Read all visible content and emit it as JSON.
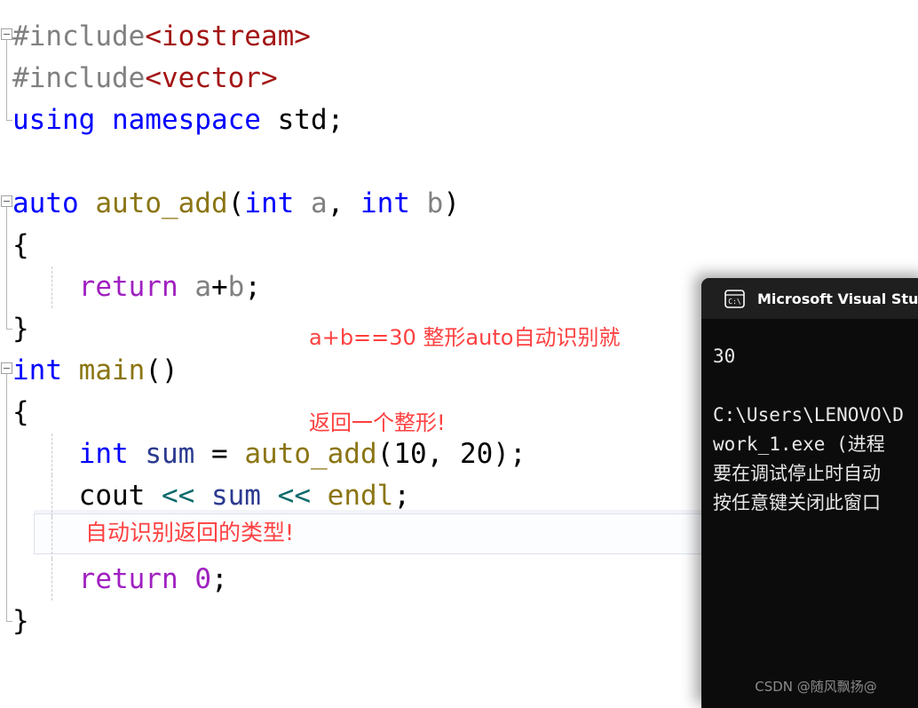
{
  "editor": {
    "name": "visual-studio-code-editor",
    "background": "#ffffff",
    "lines": [
      {
        "id": "l1",
        "fold": "start",
        "indent": false,
        "tokens": [
          {
            "text": "#include",
            "cls": "t-pre"
          },
          {
            "text": "<iostream>",
            "cls": "t-str"
          }
        ]
      },
      {
        "id": "l2",
        "fold": "mid",
        "indent": false,
        "tokens": [
          {
            "text": "#include",
            "cls": "t-pre"
          },
          {
            "text": "<vector>",
            "cls": "t-str"
          }
        ]
      },
      {
        "id": "l3",
        "fold": "endcap",
        "indent": false,
        "tokens": [
          {
            "text": "using namespace ",
            "cls": "t-kw"
          },
          {
            "text": "std;",
            "cls": "t-plain"
          }
        ]
      },
      {
        "id": "l4",
        "fold": "none",
        "indent": false,
        "tokens": []
      },
      {
        "id": "l5",
        "fold": "start",
        "indent": false,
        "tokens": [
          {
            "text": "auto",
            "cls": "t-kw"
          },
          {
            "text": " ",
            "cls": "t-plain"
          },
          {
            "text": "auto_add",
            "cls": "t-fn"
          },
          {
            "text": "(",
            "cls": "t-plain"
          },
          {
            "text": "int",
            "cls": "t-kw"
          },
          {
            "text": " ",
            "cls": "t-plain"
          },
          {
            "text": "a",
            "cls": "t-var"
          },
          {
            "text": ", ",
            "cls": "t-plain"
          },
          {
            "text": "int",
            "cls": "t-kw"
          },
          {
            "text": " ",
            "cls": "t-plain"
          },
          {
            "text": "b",
            "cls": "t-var"
          },
          {
            "text": ")",
            "cls": "t-plain"
          }
        ]
      },
      {
        "id": "l6",
        "fold": "mid",
        "indent": false,
        "tokens": [
          {
            "text": "{",
            "cls": "t-plain"
          }
        ]
      },
      {
        "id": "l7",
        "fold": "mid",
        "indent": true,
        "tokens": [
          {
            "text": "    ",
            "cls": "t-plain"
          },
          {
            "text": "return",
            "cls": "t-ret"
          },
          {
            "text": " ",
            "cls": "t-plain"
          },
          {
            "text": "a",
            "cls": "t-var"
          },
          {
            "text": "+",
            "cls": "t-plain"
          },
          {
            "text": "b",
            "cls": "t-var"
          },
          {
            "text": ";",
            "cls": "t-plain"
          }
        ]
      },
      {
        "id": "l8",
        "fold": "endcap",
        "indent": false,
        "tokens": [
          {
            "text": "}",
            "cls": "t-plain"
          }
        ]
      },
      {
        "id": "l9",
        "fold": "start",
        "indent": false,
        "tokens": [
          {
            "text": "int",
            "cls": "t-kw"
          },
          {
            "text": " ",
            "cls": "t-plain"
          },
          {
            "text": "main",
            "cls": "t-fn"
          },
          {
            "text": "()",
            "cls": "t-plain"
          }
        ]
      },
      {
        "id": "l10",
        "fold": "mid",
        "indent": false,
        "tokens": [
          {
            "text": "{",
            "cls": "t-plain"
          }
        ]
      },
      {
        "id": "l11",
        "fold": "mid",
        "indent": true,
        "tokens": [
          {
            "text": "    ",
            "cls": "t-plain"
          },
          {
            "text": "int",
            "cls": "t-kw"
          },
          {
            "text": " ",
            "cls": "t-plain"
          },
          {
            "text": "sum",
            "cls": "t-id"
          },
          {
            "text": " = ",
            "cls": "t-plain"
          },
          {
            "text": "auto_add",
            "cls": "t-fn"
          },
          {
            "text": "(",
            "cls": "t-plain"
          },
          {
            "text": "10",
            "cls": "t-num"
          },
          {
            "text": ", ",
            "cls": "t-plain"
          },
          {
            "text": "20",
            "cls": "t-num"
          },
          {
            "text": ");",
            "cls": "t-plain"
          }
        ]
      },
      {
        "id": "l12",
        "fold": "mid",
        "indent": true,
        "tokens": [
          {
            "text": "    ",
            "cls": "t-plain"
          },
          {
            "text": "cout",
            "cls": "t-plain"
          },
          {
            "text": " ",
            "cls": "t-plain"
          },
          {
            "text": "<<",
            "cls": "t-op"
          },
          {
            "text": " ",
            "cls": "t-plain"
          },
          {
            "text": "sum",
            "cls": "t-id"
          },
          {
            "text": " ",
            "cls": "t-plain"
          },
          {
            "text": "<<",
            "cls": "t-op"
          },
          {
            "text": " ",
            "cls": "t-plain"
          },
          {
            "text": "endl",
            "cls": "t-fn"
          },
          {
            "text": ";",
            "cls": "t-plain"
          }
        ]
      },
      {
        "id": "l13",
        "fold": "mid",
        "indent": true,
        "tokens": []
      },
      {
        "id": "l14",
        "fold": "mid",
        "indent": true,
        "tokens": [
          {
            "text": "    ",
            "cls": "t-plain"
          },
          {
            "text": "return",
            "cls": "t-ret"
          },
          {
            "text": " ",
            "cls": "t-plain"
          },
          {
            "text": "0",
            "cls": "t-ret"
          },
          {
            "text": ";",
            "cls": "t-plain"
          }
        ]
      },
      {
        "id": "l15",
        "fold": "endcap",
        "indent": false,
        "tokens": [
          {
            "text": "}",
            "cls": "t-plain"
          }
        ]
      }
    ],
    "annotations": {
      "return_comment_line1": "a+b==30 整形auto自动识别就",
      "return_comment_line2": "返回一个整形!",
      "auto_type_comment": "自动识别返回的类型!",
      "color": "#ff4040"
    }
  },
  "console": {
    "icon": "terminal-icon",
    "icon_label": "C:\\",
    "title": "Microsoft Visual Stud",
    "background": "#0c0c0c",
    "titlebar_background": "#1f1f1f",
    "output": [
      "30",
      "",
      "C:\\Users\\LENOVO\\D",
      "work_1.exe (进程 ",
      "要在调试停止时自动",
      "按任意键关闭此窗口"
    ],
    "watermark": "CSDN @随风飘扬@"
  }
}
